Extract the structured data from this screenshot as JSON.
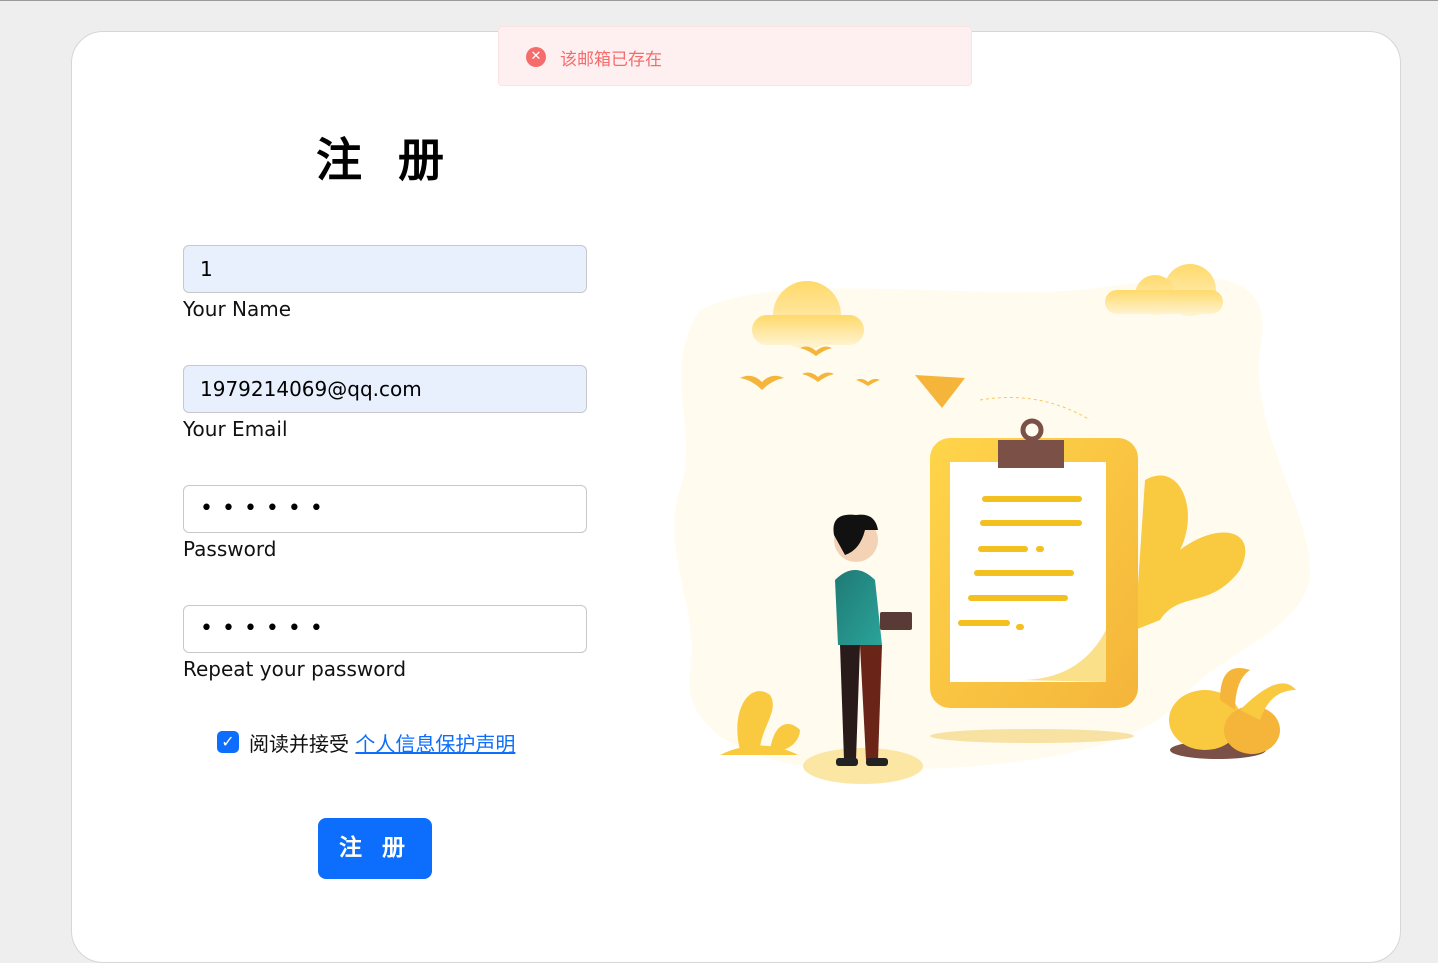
{
  "toast": {
    "message": "该邮箱已存在",
    "icon": "error-circle-icon",
    "color": "#f56c6c"
  },
  "form": {
    "title": "注 册",
    "name": {
      "value": "1",
      "label": "Your Name"
    },
    "email": {
      "value": "1979214069@qq.com",
      "label": "Your Email"
    },
    "password": {
      "value": "••••••",
      "label": "Password"
    },
    "repeat_password": {
      "value": "••••••",
      "label": "Repeat your password"
    },
    "agreement": {
      "checked": true,
      "text": "阅读并接受",
      "link": "个人信息保护声明"
    },
    "submit_label": "注 册"
  },
  "colors": {
    "primary": "#0d6efd",
    "autofill": "#e8f0fe"
  }
}
